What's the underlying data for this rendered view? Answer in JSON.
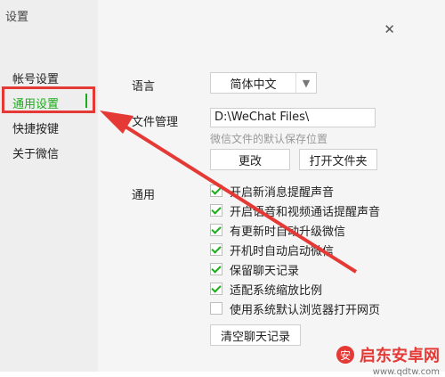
{
  "window": {
    "title": "设置",
    "close_glyph": "✕"
  },
  "sidebar": {
    "items": [
      {
        "label": "帐号设置"
      },
      {
        "label": "通用设置"
      },
      {
        "label": "快捷按键"
      },
      {
        "label": "关于微信"
      }
    ],
    "active_index": 1
  },
  "settings": {
    "language": {
      "label": "语言",
      "value": "简体中文"
    },
    "file_management": {
      "label": "文件管理",
      "path": "D:\\WeChat Files\\",
      "hint": "微信文件的默认保存位置",
      "change_button": "更改",
      "open_button": "打开文件夹"
    },
    "general": {
      "label": "通用",
      "options": [
        {
          "label": "开启新消息提醒声音",
          "checked": true
        },
        {
          "label": "开启语音和视频通话提醒声音",
          "checked": true
        },
        {
          "label": "有更新时自动升级微信",
          "checked": true
        },
        {
          "label": "开机时自动启动微信",
          "checked": true
        },
        {
          "label": "保留聊天记录",
          "checked": true
        },
        {
          "label": "适配系统缩放比例",
          "checked": true
        },
        {
          "label": "使用系统默认浏览器打开网页",
          "checked": false
        }
      ]
    },
    "clear_chat_button": "清空聊天记录"
  },
  "watermark": {
    "name": "启东安卓网",
    "url": "www.qdtw.com"
  },
  "colors": {
    "accent": "#1aad19",
    "annotation": "#e53935"
  }
}
